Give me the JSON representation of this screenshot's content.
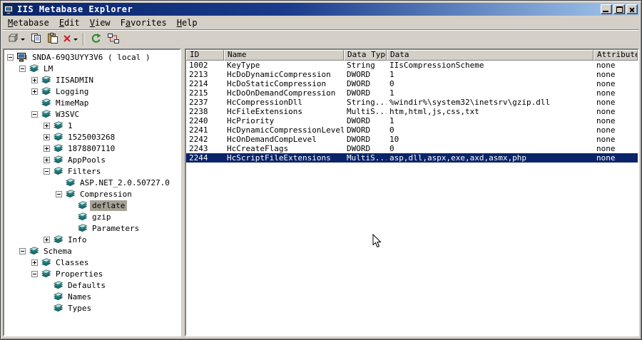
{
  "window": {
    "title": "IIS Metabase Explorer"
  },
  "menu": {
    "items": [
      {
        "label": "Metabase",
        "accel": 0
      },
      {
        "label": "Edit",
        "accel": 0
      },
      {
        "label": "View",
        "accel": 0
      },
      {
        "label": "Favorites",
        "accel": 1
      },
      {
        "label": "Help",
        "accel": 0
      }
    ]
  },
  "toolbar": {
    "buttons": [
      {
        "name": "new-key-button",
        "icon": "new-key-icon",
        "dropdown": true
      },
      {
        "name": "copy-button",
        "icon": "copy-icon"
      },
      {
        "name": "paste-button",
        "icon": "paste-icon"
      },
      {
        "name": "delete-button",
        "icon": "delete-icon",
        "dropdown": true
      },
      {
        "type": "separator"
      },
      {
        "name": "refresh-button",
        "icon": "refresh-icon"
      },
      {
        "name": "connect-button",
        "icon": "connect-icon"
      }
    ]
  },
  "tree": {
    "items": [
      {
        "label": "SNDA-69Q3UYY3V6 ( local )",
        "level": 0,
        "expand": "-",
        "icon": "computer-icon"
      },
      {
        "label": "LM",
        "level": 1,
        "expand": "-",
        "icon": "metabase-key-icon"
      },
      {
        "label": "IISADMIN",
        "level": 2,
        "expand": "+",
        "icon": "metabase-key-icon"
      },
      {
        "label": "Logging",
        "level": 2,
        "expand": "+",
        "icon": "metabase-key-icon"
      },
      {
        "label": "MimeMap",
        "level": 2,
        "expand": "",
        "icon": "metabase-key-icon"
      },
      {
        "label": "W3SVC",
        "level": 2,
        "expand": "-",
        "icon": "metabase-key-icon"
      },
      {
        "label": "1",
        "level": 3,
        "expand": "+",
        "icon": "metabase-key-icon"
      },
      {
        "label": "1525003268",
        "level": 3,
        "expand": "+",
        "icon": "metabase-key-icon"
      },
      {
        "label": "1878807110",
        "level": 3,
        "expand": "+",
        "icon": "metabase-key-icon"
      },
      {
        "label": "AppPools",
        "level": 3,
        "expand": "+",
        "icon": "metabase-key-icon"
      },
      {
        "label": "Filters",
        "level": 3,
        "expand": "-",
        "icon": "metabase-key-icon"
      },
      {
        "label": "ASP.NET_2.0.50727.0",
        "level": 4,
        "expand": "",
        "icon": "metabase-key-icon"
      },
      {
        "label": "Compression",
        "level": 4,
        "expand": "-",
        "icon": "metabase-key-icon"
      },
      {
        "label": "deflate",
        "level": 5,
        "expand": "",
        "icon": "metabase-key-icon",
        "selected": true
      },
      {
        "label": "gzip",
        "level": 5,
        "expand": "",
        "icon": "metabase-key-icon"
      },
      {
        "label": "Parameters",
        "level": 5,
        "expand": "",
        "icon": "metabase-key-icon"
      },
      {
        "label": "Info",
        "level": 3,
        "expand": "+",
        "icon": "metabase-key-icon"
      },
      {
        "label": "Schema",
        "level": 1,
        "expand": "-",
        "icon": "metabase-key-icon"
      },
      {
        "label": "Classes",
        "level": 2,
        "expand": "+",
        "icon": "metabase-key-icon"
      },
      {
        "label": "Properties",
        "level": 2,
        "expand": "-",
        "icon": "metabase-key-icon"
      },
      {
        "label": "Defaults",
        "level": 3,
        "expand": "",
        "icon": "metabase-key-icon"
      },
      {
        "label": "Names",
        "level": 3,
        "expand": "",
        "icon": "metabase-key-icon"
      },
      {
        "label": "Types",
        "level": 3,
        "expand": "",
        "icon": "metabase-key-icon"
      }
    ]
  },
  "list": {
    "columns": [
      "ID",
      "Name",
      "Data Type",
      "Data",
      "Attributes"
    ],
    "selected_row_index": 10,
    "rows": [
      [
        "1002",
        "KeyType",
        "String",
        "IIsCompressionScheme",
        "none"
      ],
      [
        "2213",
        "HcDoDynamicCompression",
        "DWORD",
        "1",
        "none"
      ],
      [
        "2214",
        "HcDoStaticCompression",
        "DWORD",
        "0",
        "none"
      ],
      [
        "2215",
        "HcDoOnDemandCompression",
        "DWORD",
        "1",
        "none"
      ],
      [
        "2237",
        "HcCompressionDll",
        "String...",
        "%windir%\\system32\\inetsrv\\gzip.dll",
        "none"
      ],
      [
        "2238",
        "HcFileExtensions",
        "MultiS...",
        "htm,html,js,css,txt",
        "none"
      ],
      [
        "2240",
        "HcPriority",
        "DWORD",
        "1",
        "none"
      ],
      [
        "2241",
        "HcDynamicCompressionLevel",
        "DWORD",
        "0",
        "none"
      ],
      [
        "2242",
        "HcOnDemandCompLevel",
        "DWORD",
        "10",
        "none"
      ],
      [
        "2243",
        "HcCreateFlags",
        "DWORD",
        "0",
        "none"
      ],
      [
        "2244",
        "HcScriptFileExtensions",
        "MultiS...",
        "asp,dll,aspx,exe,axd,asmx,php",
        "none"
      ]
    ]
  }
}
